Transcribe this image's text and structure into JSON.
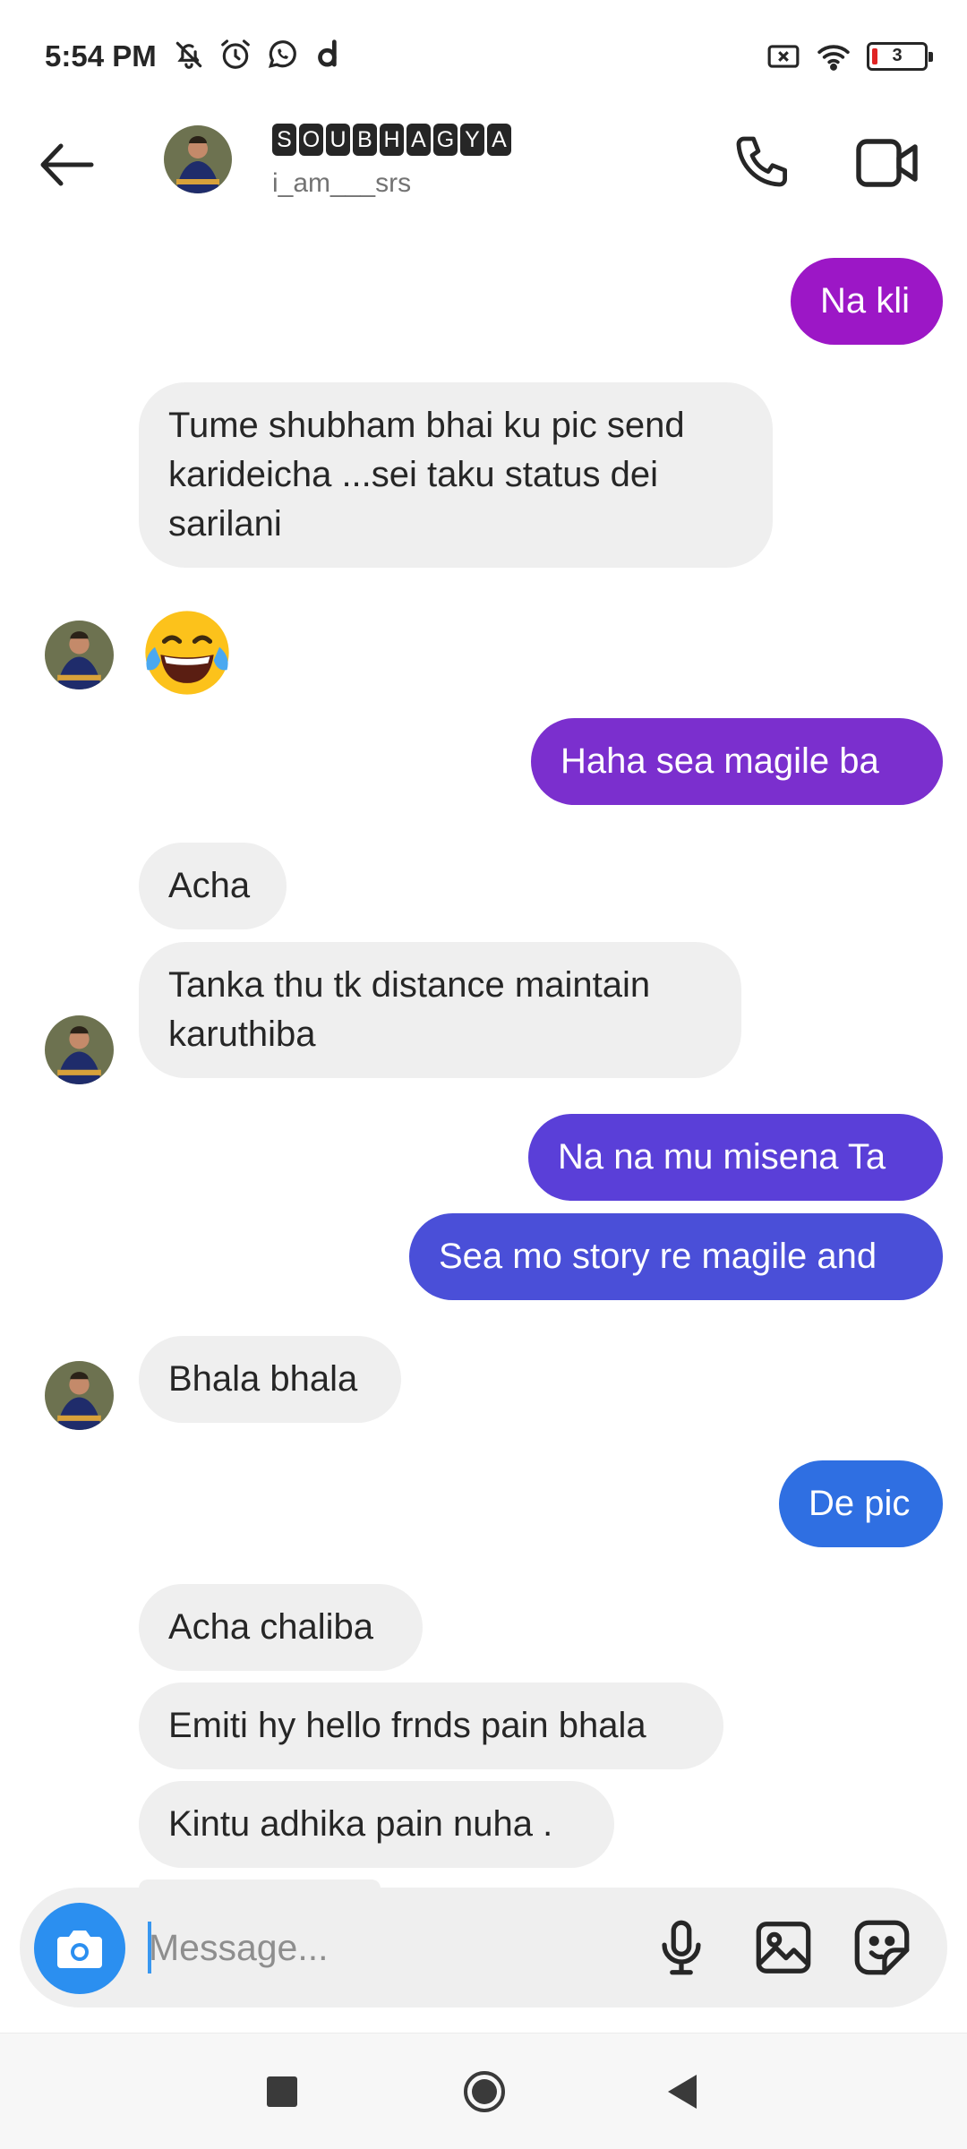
{
  "status_bar": {
    "time": "5:54 PM",
    "left_icons": [
      "bell-off-icon",
      "alarm-icon",
      "whatsapp-icon",
      "dailyhunt-icon"
    ],
    "right_icons": [
      "no-sim-icon",
      "wifi-icon"
    ],
    "battery_level": "3",
    "battery_color": "#e02424"
  },
  "header": {
    "back_icon": "arrow-left-icon",
    "contact_name": "SOUBHAGYA",
    "contact_name_letters": [
      "S",
      "O",
      "U",
      "B",
      "H",
      "A",
      "G",
      "Y",
      "A"
    ],
    "username": "i_am___srs",
    "call_icon": "phone-icon",
    "video_icon": "video-camera-icon"
  },
  "messages": [
    {
      "id": "m1",
      "direction": "out",
      "text": "Na kli",
      "color": "#9c17c6"
    },
    {
      "id": "m2",
      "direction": "in",
      "text": "Tume shubham bhai ku pic send karideicha ...sei taku status dei sarilani"
    },
    {
      "id": "m3",
      "direction": "in",
      "type": "emoji",
      "text": "😂",
      "emoji_name": "face-with-tears-of-joy"
    },
    {
      "id": "m4",
      "direction": "out",
      "text": "Haha  sea magile ba",
      "color": "#7b2fce"
    },
    {
      "id": "m5",
      "direction": "in",
      "text": "Acha"
    },
    {
      "id": "m6",
      "direction": "in",
      "text": "Tanka thu tk distance maintain karuthiba"
    },
    {
      "id": "m7",
      "direction": "out",
      "text": "Na na mu misena Ta",
      "color": "#5a3fd8"
    },
    {
      "id": "m8",
      "direction": "out",
      "text": "Sea mo story re magile and",
      "color": "#4a4fd8"
    },
    {
      "id": "m9",
      "direction": "in",
      "text": "Bhala bhala"
    },
    {
      "id": "m10",
      "direction": "out",
      "text": "De pic",
      "color": "#2f6fe2"
    },
    {
      "id": "m11",
      "direction": "in",
      "text": "Acha chaliba"
    },
    {
      "id": "m12",
      "direction": "in",
      "text": "Emiti hy hello frnds pain bhala"
    },
    {
      "id": "m13",
      "direction": "in",
      "text": "Kintu adhika pain nuha ."
    }
  ],
  "composer": {
    "placeholder": "Message...",
    "camera_icon": "camera-icon",
    "camera_color": "#2b8ff0",
    "mic_icon": "microphone-icon",
    "gallery_icon": "image-icon",
    "sticker_icon": "sticker-icon"
  },
  "nav_bar": {
    "recents_icon": "square-icon",
    "home_icon": "circle-home-icon",
    "back_icon": "triangle-back-icon"
  }
}
